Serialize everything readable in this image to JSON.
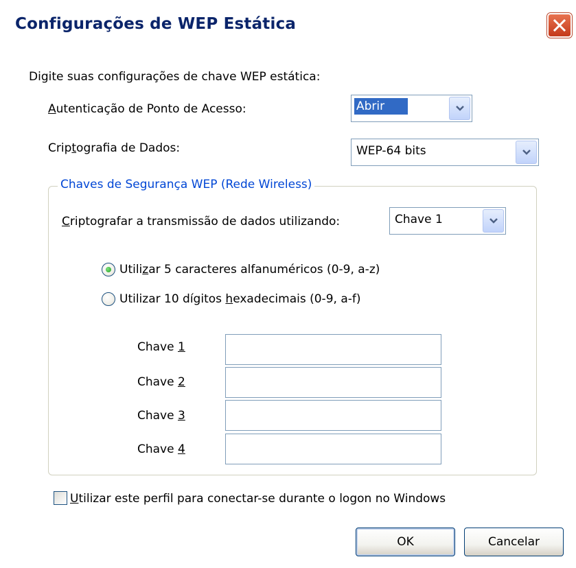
{
  "window": {
    "title": "Configurações de WEP Estática"
  },
  "intro": "Digite suas configurações de chave WEP estática:",
  "auth": {
    "label_accel": "A",
    "label_rest": "utenticação de Ponto de Acesso:",
    "value": "Abrir"
  },
  "crypto": {
    "label_pre": "Crip",
    "label_accel": "t",
    "label_rest": "ografia de Dados:",
    "value": "WEP-64 bits"
  },
  "group": {
    "title": "Chaves de Segurança WEP (Rede Wireless)",
    "transmit_label_accel": "C",
    "transmit_label_rest": "riptografar a transmissão de dados utilizando:",
    "transmit_value": "Chave 1",
    "radio1_pre": "Utili",
    "radio1_accel": "z",
    "radio1_rest": "ar 5 caracteres alfanuméricos (0-9, a-z)",
    "radio2_pre": "Utilizar 10 dígitos ",
    "radio2_accel": "h",
    "radio2_rest": "exadecimais (0-9, a-f)",
    "radio1_selected": true,
    "keys": [
      {
        "label": "Chave ",
        "accel": "1",
        "value": ""
      },
      {
        "label": "Chave ",
        "accel": "2",
        "value": ""
      },
      {
        "label": "Chave ",
        "accel": "3",
        "value": ""
      },
      {
        "label": "Chave ",
        "accel": "4",
        "value": ""
      }
    ]
  },
  "logon": {
    "label_accel": "U",
    "label_rest": "tilizar este perfil para conectar-se durante o logon no Windows",
    "checked": false
  },
  "buttons": {
    "ok": "OK",
    "cancel": "Cancelar"
  }
}
